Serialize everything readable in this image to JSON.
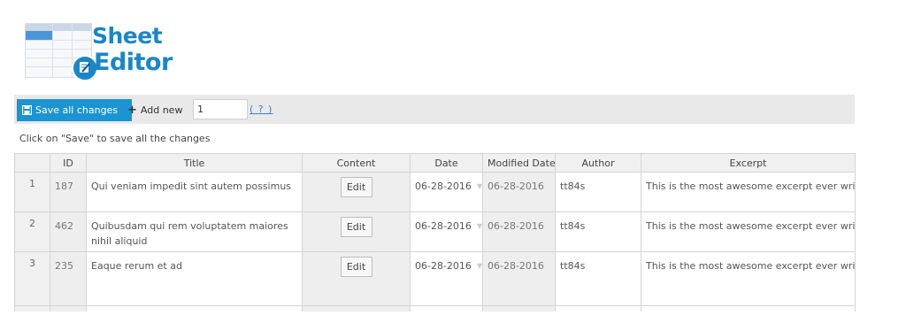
{
  "logo": {
    "line1": "Sheet",
    "line2": "Editor"
  },
  "toolbar": {
    "save_label": "Save all changes",
    "add_new_label": "Add new",
    "add_new_count": "1",
    "help_label": "( ? )"
  },
  "hint": "Click on \"Save\" to save all the changes",
  "table": {
    "headers": {
      "id": "ID",
      "title": "Title",
      "content": "Content",
      "date": "Date",
      "modified": "Modified Date",
      "author": "Author",
      "excerpt": "Excerpt"
    },
    "rows": [
      {
        "num": "1",
        "id": "187",
        "title": "Qui veniam impedit sint autem possimus",
        "content": "Edit",
        "date": "06-28-2016",
        "modified": "06-28-2016",
        "author": "tt84s",
        "excerpt": "This is the most awesome excerpt ever written..."
      },
      {
        "num": "2",
        "id": "462",
        "title": "Quibusdam qui rem voluptatem maiores nihil aliquid",
        "content": "Edit",
        "date": "06-28-2016",
        "modified": "06-28-2016",
        "author": "tt84s",
        "excerpt": "This is the most awesome excerpt ever written..."
      },
      {
        "num": "3",
        "id": "235",
        "title": "Eaque rerum et ad",
        "content": "Edit",
        "date": "06-28-2016",
        "modified": "06-28-2016",
        "author": "tt84s",
        "excerpt": "This is the most awesome excerpt ever written..."
      }
    ]
  },
  "icons": {
    "save": "floppy-disk-icon",
    "add": "plus-icon",
    "dropdown": "caret-down-icon",
    "logo_badge": "edit-document-icon"
  },
  "colors": {
    "brand_blue": "#1a86c8",
    "save_button": "#1b94d1",
    "toolbar_bg": "#e9e9e9",
    "help_link": "#3a7bd5",
    "readonly_cell": "#eeeeee"
  }
}
